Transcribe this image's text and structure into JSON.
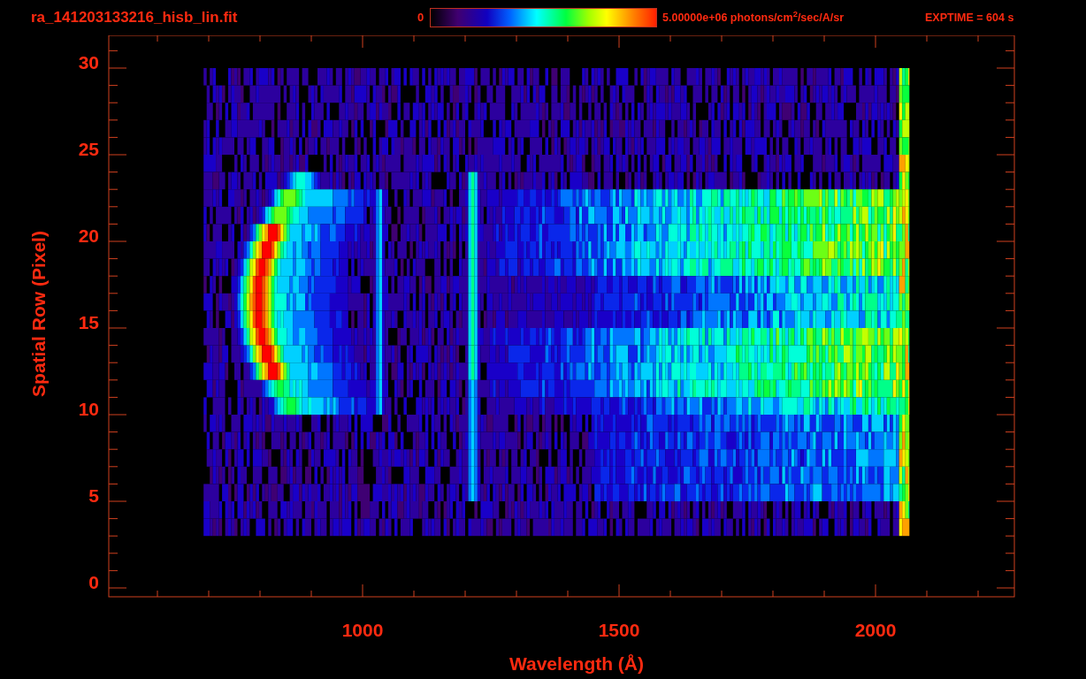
{
  "title": "ra_141203133216_hisb_lin.fit",
  "colorbar": {
    "min_label": "0",
    "max_label": "5.00000e+06 photons/cm$^{2}$/sec/A/sr"
  },
  "exposure": "EXPTIME = 604 s",
  "plot": {
    "xlabel": "Wavelength (Å)",
    "ylabel": "Spatial Row (Pixel)",
    "xticks": [
      "1000",
      "1500",
      "2000"
    ],
    "yticks": [
      "30",
      "25",
      "20",
      "15",
      "10",
      "5",
      "0"
    ]
  }
}
